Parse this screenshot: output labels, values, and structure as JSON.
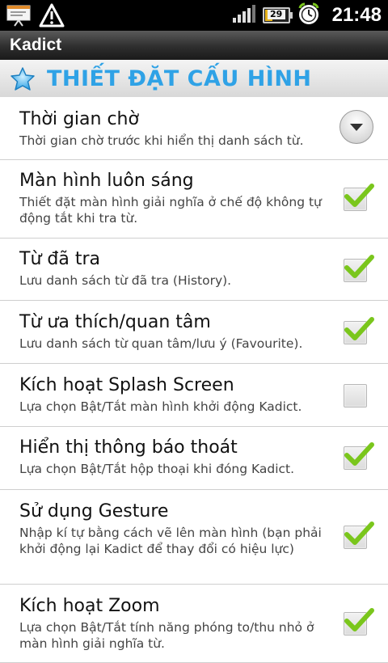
{
  "status_bar": {
    "notification_icons": [
      "presentation-icon",
      "warning-icon"
    ],
    "signal": "signal-bars-icon",
    "battery_level": "29",
    "alarm": "alarm-clock-icon",
    "time": "21:48"
  },
  "app": {
    "title": "Kadict"
  },
  "section": {
    "icon": "star-icon",
    "title": "THIẾT ĐẶT CẤU HÌNH"
  },
  "settings": [
    {
      "title": "Thời gian chờ",
      "summary": "Thời gian chờ trước khi hiển thị danh sách từ.",
      "control": "dropdown"
    },
    {
      "title": "Màn hình luôn sáng",
      "summary": "Thiết đặt màn hình giải nghĩa ở chế độ không tự động tắt khi tra từ.",
      "control": "checkbox",
      "checked": true
    },
    {
      "title": "Từ đã tra",
      "summary": "Lưu danh sách từ đã tra (History).",
      "control": "checkbox",
      "checked": true
    },
    {
      "title": "Từ ưa thích/quan tâm",
      "summary": "Lưu danh sách từ quan tâm/lưu ý (Favourite).",
      "control": "checkbox",
      "checked": true
    },
    {
      "title": "Kích hoạt Splash Screen",
      "summary": "Lựa chọn Bật/Tắt màn hình khởi động Kadict.",
      "control": "checkbox",
      "checked": false
    },
    {
      "title": "Hiển thị thông báo thoát",
      "summary": "Lựa chọn Bật/Tắt hộp thoại khi đóng Kadict.",
      "control": "checkbox",
      "checked": true
    },
    {
      "title": "Sử dụng Gesture",
      "summary": "Nhập kí tự bằng cách vẽ lên màn hình (bạn phải khởi động lại Kadict để thay đổi có hiệu lực)",
      "control": "checkbox",
      "checked": true
    },
    {
      "title": "Kích hoạt Zoom",
      "summary": "Lựa chọn Bật/Tắt tính năng phóng to/thu nhỏ ở màn hình giải nghĩa từ.",
      "control": "checkbox",
      "checked": true
    }
  ],
  "colors": {
    "accent": "#2fa2e6",
    "check": "#7ac61c"
  }
}
